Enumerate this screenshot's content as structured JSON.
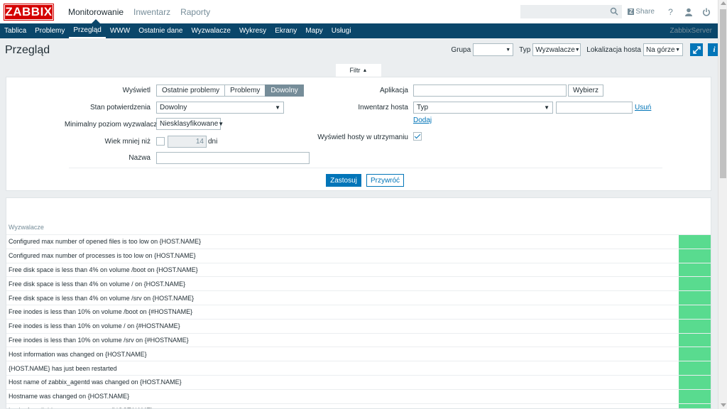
{
  "top": {
    "logo": "ZABBIX",
    "menu": [
      {
        "label": "Monitorowanie"
      },
      {
        "label": "Inwentarz"
      },
      {
        "label": "Raporty"
      }
    ],
    "share": "Share",
    "help": "?"
  },
  "nav": {
    "items": [
      {
        "label": "Tablica"
      },
      {
        "label": "Problemy"
      },
      {
        "label": "Przegląd"
      },
      {
        "label": "WWW"
      },
      {
        "label": "Ostatnie dane"
      },
      {
        "label": "Wyzwalacze"
      },
      {
        "label": "Wykresy"
      },
      {
        "label": "Ekrany"
      },
      {
        "label": "Mapy"
      },
      {
        "label": "Usługi"
      }
    ],
    "server": "ZabbixServer"
  },
  "header": {
    "title": "Przegląd",
    "group_label": "Grupa",
    "group_value": "",
    "type_label": "Typ",
    "type_value": "Wyzwalacze",
    "loc_label": "Lokalizacja hosta",
    "loc_value": "Na górze"
  },
  "filter": {
    "tab": "Filtr",
    "show_label": "Wyświetl",
    "show_options": [
      "Ostatnie problemy",
      "Problemy",
      "Dowolny"
    ],
    "ack_label": "Stan potwierdzenia",
    "ack_value": "Dowolny",
    "severity_label": "Minimalny poziom wyzwalacza",
    "severity_value": "Niesklasyfikowane",
    "age_label": "Wiek mniej niż",
    "age_value": "14",
    "age_unit": "dni",
    "name_label": "Nazwa",
    "name_value": "",
    "app_label": "Aplikacja",
    "app_value": "",
    "select_button": "Wybierz",
    "inventory_label": "Inwentarz hosta",
    "inventory_field": "Typ",
    "inventory_value": "",
    "remove_link": "Usuń",
    "add_link": "Dodaj",
    "maintenance_label": "Wyświetl hosty w utrzymaniu",
    "apply": "Zastosuj",
    "reset": "Przywróć"
  },
  "table": {
    "header": "Wyzwalacze",
    "status_color": "#59db8f",
    "rows": [
      "Configured max number of opened files is too low on {HOST.NAME}",
      "Configured max number of processes is too low on {HOST.NAME}",
      "Free disk space is less than 4% on volume /boot on {HOST.NAME}",
      "Free disk space is less than 4% on volume / on {HOST.NAME}",
      "Free disk space is less than 4% on volume /srv on {HOST.NAME}",
      "Free inodes is less than 10% on volume /boot on {#HOSTNAME}",
      "Free inodes is less than 10% on volume / on {#HOSTNAME}",
      "Free inodes is less than 10% on volume /srv on {#HOSTNAME}",
      "Host information was changed on {HOST.NAME}",
      "{HOST.NAME} has just been restarted",
      "Host name of zabbix_agentd was changed on {HOST.NAME}",
      "Hostname was changed on {HOST.NAME}",
      "Lack of available memory on server {HOST.NAME}"
    ]
  }
}
